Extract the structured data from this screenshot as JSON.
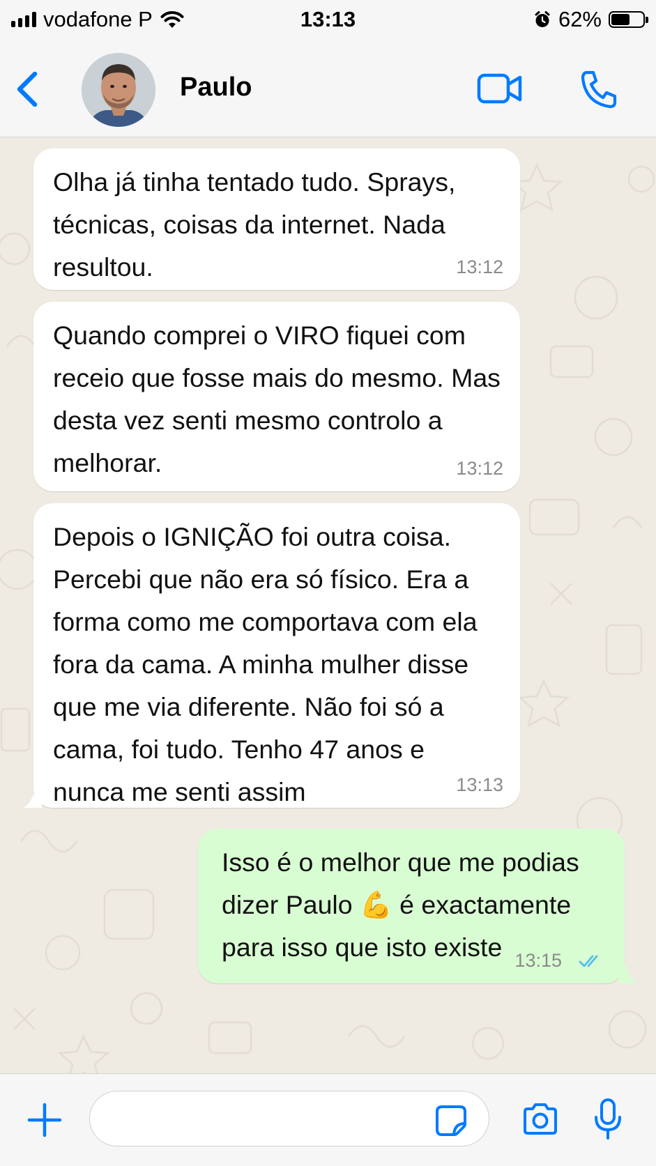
{
  "status_bar": {
    "carrier": "vodafone P",
    "time": "13:13",
    "battery": "62%",
    "battery_level": 0.62,
    "icons": [
      "signal-icon",
      "wifi-icon",
      "alarm-icon",
      "battery-icon"
    ]
  },
  "header": {
    "contact_name": "Paulo",
    "icons": [
      "back-chevron-icon",
      "avatar",
      "video-call-icon",
      "phone-call-icon"
    ]
  },
  "messages": [
    {
      "direction": "incoming",
      "text": "Olha já tinha tentado tudo. Sprays, técnicas, coisas da internet. Nada resultou.",
      "time": "13:12"
    },
    {
      "direction": "incoming",
      "text": "Quando comprei o VIRO fiquei com receio que fosse mais do mesmo. Mas desta vez senti mesmo controlo a melhorar.",
      "time": "13:12"
    },
    {
      "direction": "incoming",
      "text": "Depois o IGNIÇÃO foi outra coisa. Percebi que não era só físico. Era a forma como me comportava com ela fora da cama. A minha mulher disse que me via diferente. Não foi só a cama, foi tudo. Tenho 47 anos e nunca me senti assim",
      "time": "13:13"
    },
    {
      "direction": "outgoing",
      "text": "Isso é o melhor que me podias dizer Paulo 💪 é exactamente para isso que isto existe",
      "time": "13:15",
      "status": "read"
    }
  ],
  "input_bar": {
    "placeholder": "",
    "value": "",
    "icons": [
      "plus-icon",
      "sticker-icon",
      "camera-icon",
      "microphone-icon"
    ]
  },
  "colors": {
    "accent": "#007aff",
    "chat_background": "#efeae2",
    "incoming_bubble": "#ffffff",
    "outgoing_bubble": "#d9fdd3",
    "read_ticks": "#53bdeb"
  }
}
